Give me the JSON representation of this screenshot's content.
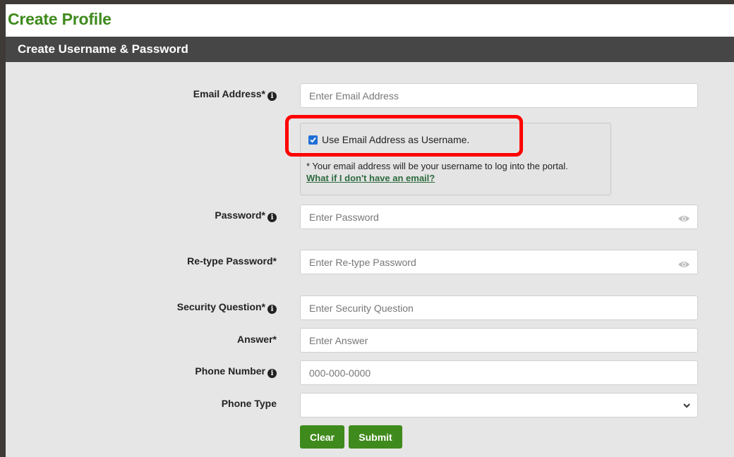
{
  "page_title": "Create Profile",
  "section_header": "Create Username & Password",
  "fields": {
    "email": {
      "label": "Email Address*",
      "placeholder": "Enter Email Address",
      "has_info": true
    },
    "password": {
      "label": "Password*",
      "placeholder": "Enter Password",
      "has_info": true,
      "reveal_icon": "eye-icon"
    },
    "retype_password": {
      "label": "Re-type Password*",
      "placeholder": "Enter Re-type Password",
      "reveal_icon": "eye-icon"
    },
    "security_question": {
      "label": "Security Question*",
      "placeholder": "Enter Security Question",
      "has_info": true
    },
    "answer": {
      "label": "Answer*",
      "placeholder": "Enter Answer"
    },
    "phone_number": {
      "label": "Phone Number",
      "placeholder": "000-000-0000",
      "has_info": true
    },
    "phone_type": {
      "label": "Phone Type",
      "value": ""
    }
  },
  "username_option": {
    "checkbox_label": "Use Email Address as Username.",
    "checked": true,
    "note": "* Your email address will be your username to log into the portal.",
    "help_link": "What if I don't have an email?"
  },
  "info_icon_glyph": "i",
  "buttons": {
    "clear": "Clear",
    "submit": "Submit"
  },
  "colors": {
    "accent": "#3f8a1c",
    "header": "#464646",
    "highlight": "#ff0000",
    "checkbox": "#1f6fd6"
  }
}
